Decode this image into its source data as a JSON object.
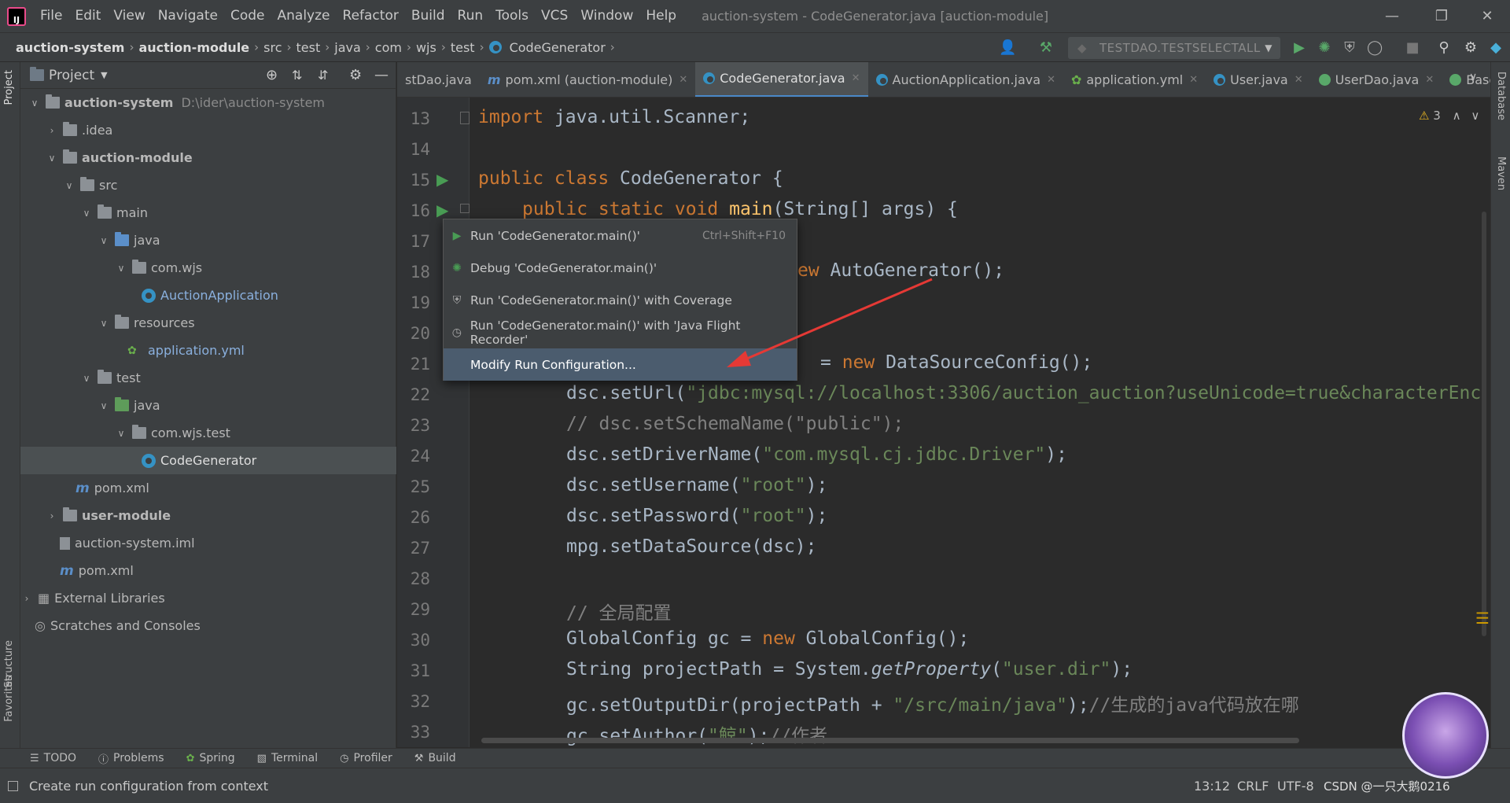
{
  "menubar": {
    "items": [
      "File",
      "Edit",
      "View",
      "Navigate",
      "Code",
      "Analyze",
      "Refactor",
      "Build",
      "Run",
      "Tools",
      "VCS",
      "Window",
      "Help"
    ],
    "window_title": "auction-system - CodeGenerator.java [auction-module]"
  },
  "navbar": {
    "crumbs": [
      "auction-system",
      "auction-module",
      "src",
      "test",
      "java",
      "com",
      "wjs",
      "test",
      "CodeGenerator"
    ],
    "run_config": "TESTDAO.TESTSELECTALL"
  },
  "left_stripe": {
    "project": "Project",
    "structure": "Structure",
    "favorites": "Favorites"
  },
  "project_panel": {
    "title": "Project",
    "tree": [
      {
        "label": "auction-system",
        "extra": "D:\\ider\\auction-system"
      },
      {
        "label": ".idea"
      },
      {
        "label": "auction-module"
      },
      {
        "label": "src"
      },
      {
        "label": "main"
      },
      {
        "label": "java"
      },
      {
        "label": "com.wjs"
      },
      {
        "label": "AuctionApplication"
      },
      {
        "label": "resources"
      },
      {
        "label": "application.yml"
      },
      {
        "label": "test"
      },
      {
        "label": "java"
      },
      {
        "label": "com.wjs.test"
      },
      {
        "label": "CodeGenerator"
      },
      {
        "label": "pom.xml"
      },
      {
        "label": "user-module"
      },
      {
        "label": "auction-system.iml"
      },
      {
        "label": "pom.xml"
      },
      {
        "label": "External Libraries"
      },
      {
        "label": "Scratches and Consoles"
      }
    ]
  },
  "tabs": [
    "stDao.java",
    "pom.xml (auction-module)",
    "CodeGenerator.java",
    "AuctionApplication.java",
    "application.yml",
    "User.java",
    "UserDao.java",
    "BaseMa"
  ],
  "editor": {
    "line_numbers": [
      "13",
      "14",
      "15",
      "16",
      "17",
      "18",
      "19",
      "20",
      "21",
      "22",
      "23",
      "24",
      "25",
      "26",
      "27",
      "28",
      "29",
      "30",
      "31",
      "32",
      "33"
    ],
    "warnings": "3",
    "line13_kw": "import",
    "line13_rest": " java.util.Scanner;",
    "line15_kw": "public class",
    "line15_rest": " CodeGenerator {",
    "line16_kw": "public static void",
    "line16_fn": "main",
    "line16_rest": "(String[] args) {",
    "line18_kw": "ew",
    "line18_rest": " AutoGenerator();",
    "line21_eq": "=",
    "line21_kw": "new",
    "line21_rest": " DataSourceConfig();",
    "line22_pre": "dsc.setUrl(",
    "line22_str": "\"jdbc:mysql://localhost:3306/auction_auction?useUnicode=true&characterEnc",
    "line23_cmt": "// dsc.setSchemaName(\"public\");",
    "line24_pre": "dsc.setDriverName(",
    "line24_str": "\"com.mysql.cj.jdbc.Driver\"",
    "line24_post": ");",
    "line25_pre": "dsc.setUsername(",
    "line25_str": "\"root\"",
    "line25_post": ");",
    "line26_pre": "dsc.setPassword(",
    "line26_str": "\"root\"",
    "line26_post": ");",
    "line27": "mpg.setDataSource(dsc);",
    "line29_cmt": "// 全局配置",
    "line30_pre": "GlobalConfig gc = ",
    "line30_kw": "new",
    "line30_rest": " GlobalConfig();",
    "line31_pre": "String projectPath = System.",
    "line31_it": "getProperty",
    "line31_str": "\"user.dir\"",
    "line31_post": ");",
    "line32_pre": "gc.setOutputDir(projectPath + ",
    "line32_str": "\"/src/main/java\"",
    "line32_post": ");",
    "line32_cmt": "//生成的java代码放在哪",
    "line33_pre": "gc.setAuthor(",
    "line33_str": "\"鲸\"",
    "line33_post": ");",
    "line33_cmt": "//作者"
  },
  "popup": {
    "items": [
      {
        "label": "Run 'CodeGenerator.main()'",
        "shortcut": "Ctrl+Shift+F10"
      },
      {
        "label": "Debug 'CodeGenerator.main()'"
      },
      {
        "label": "Run 'CodeGenerator.main()' with Coverage"
      },
      {
        "label": "Run 'CodeGenerator.main()' with 'Java Flight Recorder'"
      },
      {
        "label": "Modify Run Configuration..."
      }
    ]
  },
  "right_stripe": {
    "database": "Database",
    "maven": "Maven"
  },
  "toolwindows": [
    "TODO",
    "Problems",
    "Spring",
    "Terminal",
    "Profiler",
    "Build"
  ],
  "statusbar": {
    "message": "Create run configuration from context",
    "position": "13:12",
    "line_sep": "CRLF",
    "encoding": "UTF-8",
    "watermark": "CSDN @一只大鹅0216"
  }
}
